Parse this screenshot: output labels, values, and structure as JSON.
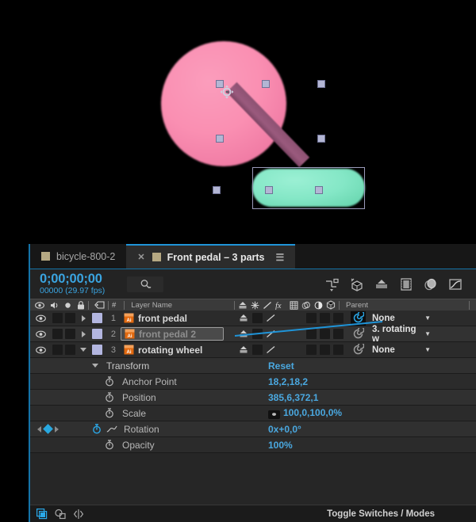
{
  "app": "Adobe After Effects Timeline Panel",
  "viewport": {
    "background": "#000000",
    "shapes": [
      {
        "name": "pink-wheel",
        "kind": "circle",
        "color": "#fa8fb2"
      },
      {
        "name": "crank-arm",
        "kind": "rotated-bar",
        "color": "#8d5172"
      },
      {
        "name": "green-pedal",
        "kind": "rounded-rect",
        "color": "#84e7c6"
      }
    ],
    "selection_handles": 7,
    "anchor_icon": "anchor-point-icon"
  },
  "tabs": [
    {
      "label": "bicycle-800-2",
      "active": false,
      "closable": false
    },
    {
      "label": "Front pedal – 3 parts",
      "active": true,
      "closable": true
    }
  ],
  "toolbar": {
    "timecode": "0;00;00;00",
    "frames_fps": "00000 (29.97 fps)",
    "search_placeholder": "",
    "search_icon": "search-icon",
    "icons": [
      "composition-mini-flowchart-icon",
      "draft-3d-icon",
      "hide-shy-layers-icon",
      "frame-blending-icon",
      "motion-blur-icon",
      "graph-editor-icon"
    ]
  },
  "columns": {
    "av_features": [
      "eye-icon",
      "audio-icon",
      "solo-icon",
      "lock-icon"
    ],
    "label_icon": "label-tag-icon",
    "index": "#",
    "layer_name": "Layer Name",
    "switches": [
      "shy-icon",
      "collapse-icon",
      "quality-icon",
      "fx-icon",
      "frame-blend-icon",
      "motion-blur-icon",
      "adjustment-icon",
      "3d-icon"
    ],
    "parent": "Parent"
  },
  "layers": [
    {
      "index": "1",
      "name": "front pedal",
      "source_icon": "illustrator-file-icon",
      "expanded": false,
      "visible": true,
      "editing": false,
      "parent": "None",
      "parent_highlight": true
    },
    {
      "index": "2",
      "name": "front pedal 2",
      "source_icon": "illustrator-file-icon",
      "expanded": false,
      "visible": true,
      "editing": true,
      "parent": "3. rotating w",
      "parent_highlight": false
    },
    {
      "index": "3",
      "name": "rotating wheel",
      "source_icon": "illustrator-file-icon",
      "expanded": true,
      "visible": true,
      "editing": false,
      "parent": "None",
      "parent_highlight": false
    }
  ],
  "transform": {
    "group_label": "Transform",
    "reset_label": "Reset",
    "properties": [
      {
        "label": "Anchor Point",
        "value": "18,2,18,2",
        "stopwatch": "off",
        "linked": false,
        "keyframes": false,
        "graph": false
      },
      {
        "label": "Position",
        "value": "385,6,372,1",
        "stopwatch": "off",
        "linked": false,
        "keyframes": false,
        "graph": false
      },
      {
        "label": "Scale",
        "value": "100,0,100,0%",
        "stopwatch": "off",
        "linked": true,
        "keyframes": false,
        "graph": false
      },
      {
        "label": "Rotation",
        "value": "0x+0,0°",
        "stopwatch": "on",
        "linked": false,
        "keyframes": true,
        "graph": true
      },
      {
        "label": "Opacity",
        "value": "100%",
        "stopwatch": "off",
        "linked": false,
        "keyframes": false,
        "graph": false
      }
    ]
  },
  "statusbar": {
    "icons": [
      "comp-flowchart-icon",
      "layer-switches-icon",
      "expand-collapse-icon"
    ],
    "toggle_label": "Toggle Switches / Modes"
  },
  "colors": {
    "accent_blue": "#1f94d8",
    "value_blue": "#4aa8e0",
    "panel_bg": "#1f1f1f",
    "row_bg": "#2b2b2b",
    "tab_gold": "#b6a983",
    "pink": "#fa8fb2",
    "green": "#84e7c6",
    "crank": "#8d5172"
  }
}
